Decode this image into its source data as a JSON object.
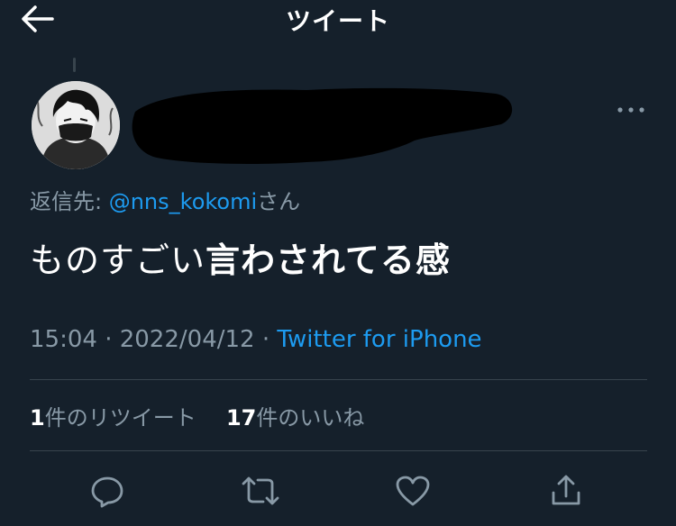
{
  "header": {
    "title": "ツイート",
    "back_icon": "arrow-left-icon"
  },
  "tweet": {
    "avatar_icon": "user-avatar",
    "more_icon": "more-horizontal-icon",
    "reply_prefix": "返信先: ",
    "reply_handle": "@nns_kokomi",
    "reply_suffix": "さん",
    "text_plain": "ものすごい",
    "text_bold": "言わされてる感",
    "time": "15:04 · 2022/04/12 · ",
    "source": "Twitter for iPhone"
  },
  "stats": {
    "retweet_count": "1",
    "retweet_label": "件のリツイート",
    "like_count": "17",
    "like_label": "件のいいね"
  },
  "actions": {
    "reply_icon": "reply-icon",
    "retweet_icon": "retweet-icon",
    "like_icon": "heart-icon",
    "share_icon": "share-icon"
  },
  "colors": {
    "background": "#15202b",
    "accent": "#1d9bf0",
    "secondary_text": "#8899a6",
    "divider": "#38444d"
  }
}
